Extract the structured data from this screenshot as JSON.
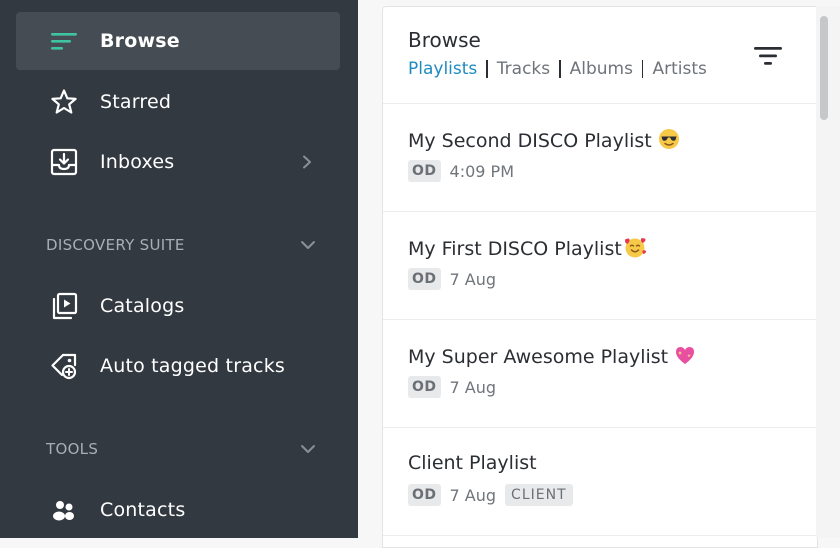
{
  "sidebar": {
    "items": [
      {
        "label": "Browse",
        "icon": "browse-lines-icon",
        "active": true
      },
      {
        "label": "Starred",
        "icon": "star-icon"
      },
      {
        "label": "Inboxes",
        "icon": "inbox-download-icon"
      }
    ],
    "sections": [
      {
        "title": "DISCOVERY SUITE",
        "items": [
          {
            "label": "Catalogs",
            "icon": "catalog-play-icon"
          },
          {
            "label": "Auto tagged tracks",
            "icon": "tag-plus-icon"
          }
        ]
      },
      {
        "title": "TOOLS",
        "items": [
          {
            "label": "Contacts",
            "icon": "contacts-icon"
          }
        ]
      }
    ]
  },
  "panel": {
    "title": "Browse",
    "tabs": [
      "Playlists",
      "Tracks",
      "Albums",
      "Artists"
    ],
    "active_tab": "Playlists"
  },
  "playlists": [
    {
      "title": "My Second DISCO Playlist",
      "emoji": "sunglasses-emoji",
      "badge": "OD",
      "time": "4:09 PM"
    },
    {
      "title": "My First DISCO Playlist",
      "emoji": "smiling-hearts-emoji",
      "badge": "OD",
      "time": "7 Aug"
    },
    {
      "title": "My Super Awesome Playlist",
      "emoji": "sparkling-heart-emoji",
      "badge": "OD",
      "time": "7 Aug"
    },
    {
      "title": "Client Playlist",
      "badge": "OD",
      "time": "7 Aug",
      "tag": "CLIENT"
    }
  ],
  "colors": {
    "sidebar_bg": "#333940",
    "sidebar_active_bg": "#464c54",
    "accent_teal": "#3fc4a2",
    "link_blue": "#1f8ac0"
  }
}
